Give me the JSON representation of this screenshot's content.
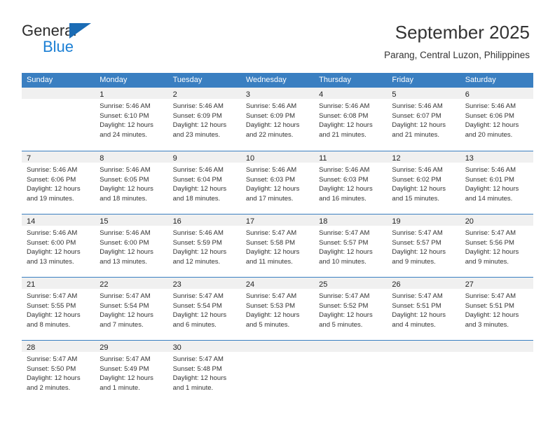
{
  "brand": {
    "line1": "General",
    "line2": "Blue",
    "accent": "#1b7fd4",
    "triangle": "#1b6cb5"
  },
  "header": {
    "title": "September 2025",
    "subtitle": "Parang, Central Luzon, Philippines"
  },
  "theme": {
    "header_row_bg": "#3a7fc1",
    "day_band_bg": "#f0f0f0",
    "text": "#333333"
  },
  "weekdays": [
    "Sunday",
    "Monday",
    "Tuesday",
    "Wednesday",
    "Thursday",
    "Friday",
    "Saturday"
  ],
  "weeks": [
    [
      {
        "day": "",
        "sunrise": "",
        "sunset": "",
        "daylight1": "",
        "daylight2": ""
      },
      {
        "day": "1",
        "sunrise": "Sunrise: 5:46 AM",
        "sunset": "Sunset: 6:10 PM",
        "daylight1": "Daylight: 12 hours",
        "daylight2": "and 24 minutes."
      },
      {
        "day": "2",
        "sunrise": "Sunrise: 5:46 AM",
        "sunset": "Sunset: 6:09 PM",
        "daylight1": "Daylight: 12 hours",
        "daylight2": "and 23 minutes."
      },
      {
        "day": "3",
        "sunrise": "Sunrise: 5:46 AM",
        "sunset": "Sunset: 6:09 PM",
        "daylight1": "Daylight: 12 hours",
        "daylight2": "and 22 minutes."
      },
      {
        "day": "4",
        "sunrise": "Sunrise: 5:46 AM",
        "sunset": "Sunset: 6:08 PM",
        "daylight1": "Daylight: 12 hours",
        "daylight2": "and 21 minutes."
      },
      {
        "day": "5",
        "sunrise": "Sunrise: 5:46 AM",
        "sunset": "Sunset: 6:07 PM",
        "daylight1": "Daylight: 12 hours",
        "daylight2": "and 21 minutes."
      },
      {
        "day": "6",
        "sunrise": "Sunrise: 5:46 AM",
        "sunset": "Sunset: 6:06 PM",
        "daylight1": "Daylight: 12 hours",
        "daylight2": "and 20 minutes."
      }
    ],
    [
      {
        "day": "7",
        "sunrise": "Sunrise: 5:46 AM",
        "sunset": "Sunset: 6:06 PM",
        "daylight1": "Daylight: 12 hours",
        "daylight2": "and 19 minutes."
      },
      {
        "day": "8",
        "sunrise": "Sunrise: 5:46 AM",
        "sunset": "Sunset: 6:05 PM",
        "daylight1": "Daylight: 12 hours",
        "daylight2": "and 18 minutes."
      },
      {
        "day": "9",
        "sunrise": "Sunrise: 5:46 AM",
        "sunset": "Sunset: 6:04 PM",
        "daylight1": "Daylight: 12 hours",
        "daylight2": "and 18 minutes."
      },
      {
        "day": "10",
        "sunrise": "Sunrise: 5:46 AM",
        "sunset": "Sunset: 6:03 PM",
        "daylight1": "Daylight: 12 hours",
        "daylight2": "and 17 minutes."
      },
      {
        "day": "11",
        "sunrise": "Sunrise: 5:46 AM",
        "sunset": "Sunset: 6:03 PM",
        "daylight1": "Daylight: 12 hours",
        "daylight2": "and 16 minutes."
      },
      {
        "day": "12",
        "sunrise": "Sunrise: 5:46 AM",
        "sunset": "Sunset: 6:02 PM",
        "daylight1": "Daylight: 12 hours",
        "daylight2": "and 15 minutes."
      },
      {
        "day": "13",
        "sunrise": "Sunrise: 5:46 AM",
        "sunset": "Sunset: 6:01 PM",
        "daylight1": "Daylight: 12 hours",
        "daylight2": "and 14 minutes."
      }
    ],
    [
      {
        "day": "14",
        "sunrise": "Sunrise: 5:46 AM",
        "sunset": "Sunset: 6:00 PM",
        "daylight1": "Daylight: 12 hours",
        "daylight2": "and 13 minutes."
      },
      {
        "day": "15",
        "sunrise": "Sunrise: 5:46 AM",
        "sunset": "Sunset: 6:00 PM",
        "daylight1": "Daylight: 12 hours",
        "daylight2": "and 13 minutes."
      },
      {
        "day": "16",
        "sunrise": "Sunrise: 5:46 AM",
        "sunset": "Sunset: 5:59 PM",
        "daylight1": "Daylight: 12 hours",
        "daylight2": "and 12 minutes."
      },
      {
        "day": "17",
        "sunrise": "Sunrise: 5:47 AM",
        "sunset": "Sunset: 5:58 PM",
        "daylight1": "Daylight: 12 hours",
        "daylight2": "and 11 minutes."
      },
      {
        "day": "18",
        "sunrise": "Sunrise: 5:47 AM",
        "sunset": "Sunset: 5:57 PM",
        "daylight1": "Daylight: 12 hours",
        "daylight2": "and 10 minutes."
      },
      {
        "day": "19",
        "sunrise": "Sunrise: 5:47 AM",
        "sunset": "Sunset: 5:57 PM",
        "daylight1": "Daylight: 12 hours",
        "daylight2": "and 9 minutes."
      },
      {
        "day": "20",
        "sunrise": "Sunrise: 5:47 AM",
        "sunset": "Sunset: 5:56 PM",
        "daylight1": "Daylight: 12 hours",
        "daylight2": "and 9 minutes."
      }
    ],
    [
      {
        "day": "21",
        "sunrise": "Sunrise: 5:47 AM",
        "sunset": "Sunset: 5:55 PM",
        "daylight1": "Daylight: 12 hours",
        "daylight2": "and 8 minutes."
      },
      {
        "day": "22",
        "sunrise": "Sunrise: 5:47 AM",
        "sunset": "Sunset: 5:54 PM",
        "daylight1": "Daylight: 12 hours",
        "daylight2": "and 7 minutes."
      },
      {
        "day": "23",
        "sunrise": "Sunrise: 5:47 AM",
        "sunset": "Sunset: 5:54 PM",
        "daylight1": "Daylight: 12 hours",
        "daylight2": "and 6 minutes."
      },
      {
        "day": "24",
        "sunrise": "Sunrise: 5:47 AM",
        "sunset": "Sunset: 5:53 PM",
        "daylight1": "Daylight: 12 hours",
        "daylight2": "and 5 minutes."
      },
      {
        "day": "25",
        "sunrise": "Sunrise: 5:47 AM",
        "sunset": "Sunset: 5:52 PM",
        "daylight1": "Daylight: 12 hours",
        "daylight2": "and 5 minutes."
      },
      {
        "day": "26",
        "sunrise": "Sunrise: 5:47 AM",
        "sunset": "Sunset: 5:51 PM",
        "daylight1": "Daylight: 12 hours",
        "daylight2": "and 4 minutes."
      },
      {
        "day": "27",
        "sunrise": "Sunrise: 5:47 AM",
        "sunset": "Sunset: 5:51 PM",
        "daylight1": "Daylight: 12 hours",
        "daylight2": "and 3 minutes."
      }
    ],
    [
      {
        "day": "28",
        "sunrise": "Sunrise: 5:47 AM",
        "sunset": "Sunset: 5:50 PM",
        "daylight1": "Daylight: 12 hours",
        "daylight2": "and 2 minutes."
      },
      {
        "day": "29",
        "sunrise": "Sunrise: 5:47 AM",
        "sunset": "Sunset: 5:49 PM",
        "daylight1": "Daylight: 12 hours",
        "daylight2": "and 1 minute."
      },
      {
        "day": "30",
        "sunrise": "Sunrise: 5:47 AM",
        "sunset": "Sunset: 5:48 PM",
        "daylight1": "Daylight: 12 hours",
        "daylight2": "and 1 minute."
      },
      {
        "day": "",
        "sunrise": "",
        "sunset": "",
        "daylight1": "",
        "daylight2": ""
      },
      {
        "day": "",
        "sunrise": "",
        "sunset": "",
        "daylight1": "",
        "daylight2": ""
      },
      {
        "day": "",
        "sunrise": "",
        "sunset": "",
        "daylight1": "",
        "daylight2": ""
      },
      {
        "day": "",
        "sunrise": "",
        "sunset": "",
        "daylight1": "",
        "daylight2": ""
      }
    ]
  ]
}
